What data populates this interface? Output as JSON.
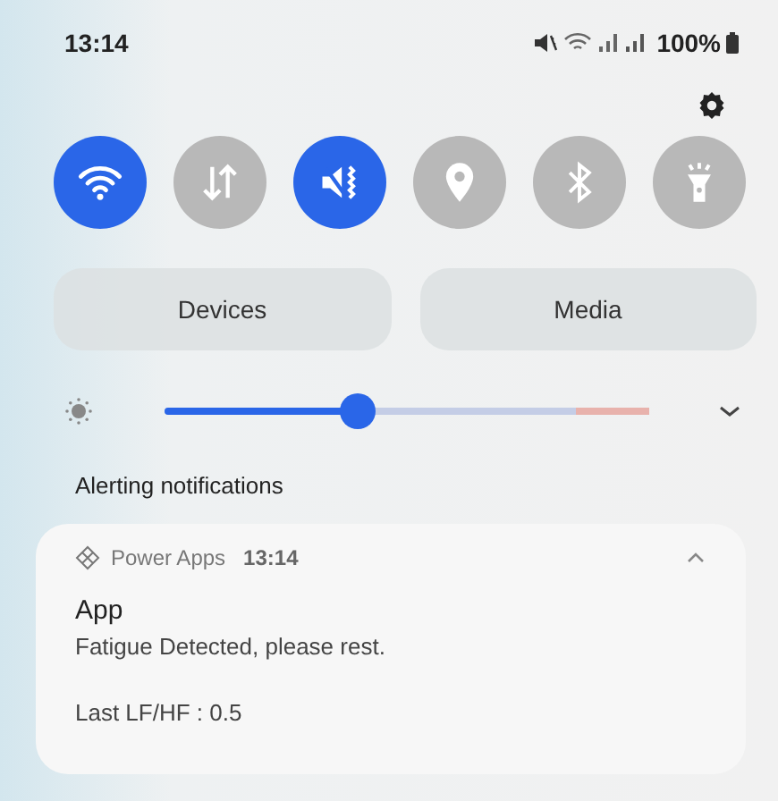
{
  "status_bar": {
    "time": "13:14",
    "battery": "100%"
  },
  "toggles": [
    {
      "kind": "wifi",
      "on": true
    },
    {
      "kind": "data",
      "on": false
    },
    {
      "kind": "mute",
      "on": true
    },
    {
      "kind": "location",
      "on": false
    },
    {
      "kind": "bluetooth",
      "on": false
    },
    {
      "kind": "flashlight",
      "on": false
    }
  ],
  "buttons": [
    "Devices",
    "Media"
  ],
  "brightness": {
    "level": 0.4
  },
  "section_title": "Alerting notifications",
  "notification": {
    "app": "Power Apps",
    "time": "13:14",
    "expanded": true,
    "title": "App",
    "body": "Fatigue Detected, please rest.",
    "detail": "Last LF/HF : 0.5"
  }
}
